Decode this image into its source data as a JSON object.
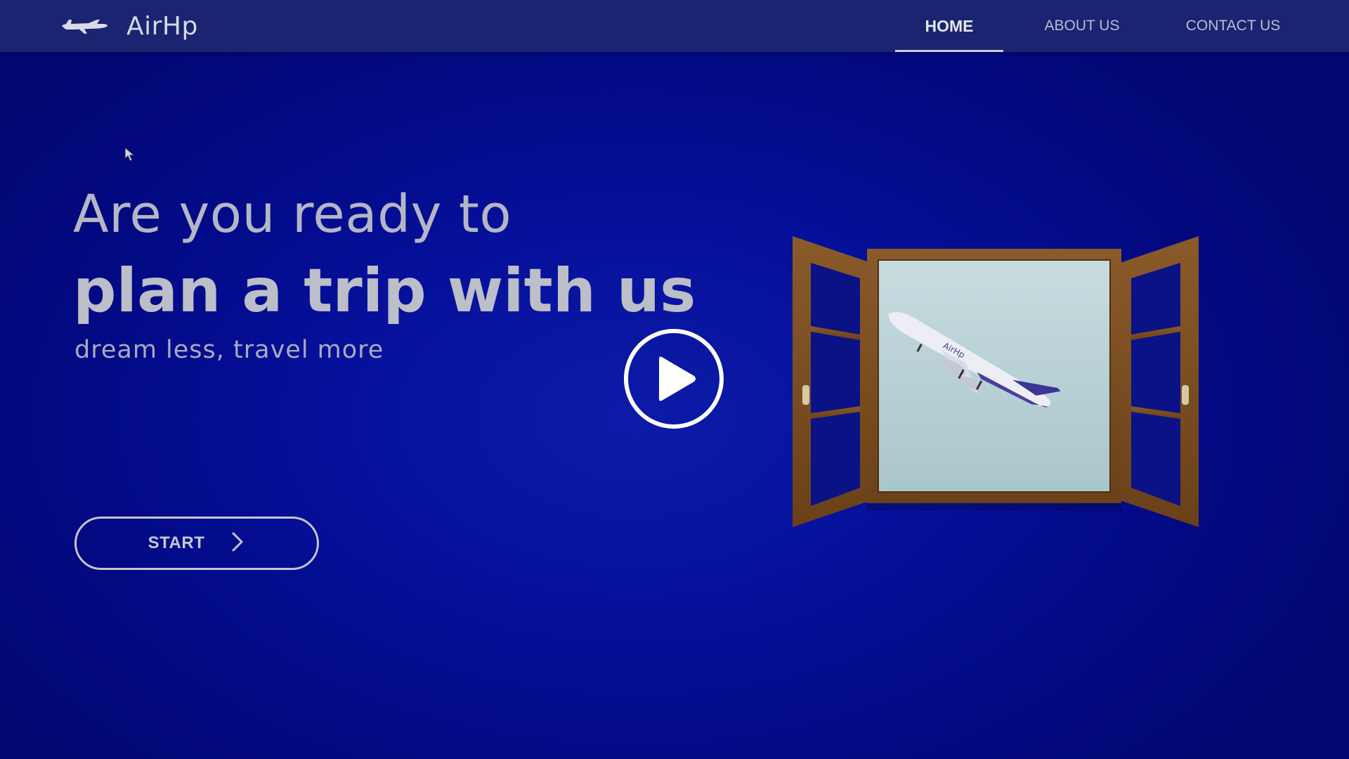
{
  "brand": {
    "name": "AirHp",
    "logo_icon": "airplane-icon"
  },
  "nav": {
    "items": [
      {
        "label": "HOME",
        "active": true
      },
      {
        "label": "ABOUT US",
        "active": false
      },
      {
        "label": "CONTACT US",
        "active": false
      }
    ]
  },
  "hero": {
    "line1": "Are you ready to",
    "line2": "plan a trip with us",
    "tagline": "dream less, travel more",
    "start_label": "START",
    "start_icon": "chevron-right-icon",
    "play_icon": "play-icon",
    "illustration": "window-with-airplane"
  },
  "colors": {
    "background": "#020a7a",
    "navbar": "#1a2470",
    "text": "#b4b6c6",
    "window_frame": "#7a4e22",
    "sky": "#b7d3d8"
  }
}
